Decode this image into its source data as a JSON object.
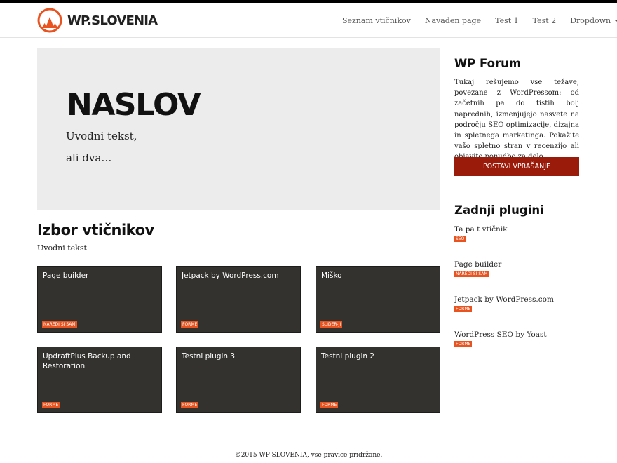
{
  "brand": {
    "name": "WP.SLOVENIA",
    "accent_color": "#e8531f"
  },
  "nav": {
    "items": [
      {
        "label": "Seznam vtičnikov"
      },
      {
        "label": "Navaden page"
      },
      {
        "label": "Test 1"
      },
      {
        "label": "Test 2"
      },
      {
        "label": "Dropdown",
        "has_caret": true
      }
    ]
  },
  "hero": {
    "title": "NASLOV",
    "line1": "Uvodni tekst,",
    "line2": "ali dva…"
  },
  "plugins_section": {
    "title": "Izbor vtičnikov",
    "subtitle": "Uvodni tekst",
    "cards": [
      {
        "title": "Page builder",
        "tag": "NAREDI SI SAM"
      },
      {
        "title": "Jetpack by WordPress.com",
        "tag": "FORME"
      },
      {
        "title": "Miško",
        "tag": "SLIDER-JI"
      },
      {
        "title": "UpdraftPlus Backup and Restoration",
        "tag": "FORME"
      },
      {
        "title": "Testni plugin 3",
        "tag": "FORME"
      },
      {
        "title": "Testni plugin 2",
        "tag": "FORME"
      }
    ]
  },
  "sidebar": {
    "forum": {
      "title": "WP Forum",
      "text": "Tukaj rešujemo vse težave, povezane z WordPressom: od začetnih pa do tistih bolj naprednih, izmenjujejo nasvete na področju SEO optimizacije, dizajna in spletnega marketinga. Pokažite vašo spletno stran v recenzijo ali objavite ponudbo za delo...",
      "button_label": "POSTAVI VPRAŠANJE",
      "button_color": "#9b1b0a"
    },
    "latest": {
      "title": "Zadnji plugini",
      "items": [
        {
          "name": "Ta pa t vtičnik",
          "tag": "SEO"
        },
        {
          "name": "Page builder",
          "tag": "NAREDI SI SAM"
        },
        {
          "name": "Jetpack by WordPress.com",
          "tag": "FORME"
        },
        {
          "name": "WordPress SEO by Yoast",
          "tag": "FORME"
        }
      ]
    }
  },
  "footer": {
    "text": "©2015 WP SLOVENIA, vse pravice pridržane."
  }
}
